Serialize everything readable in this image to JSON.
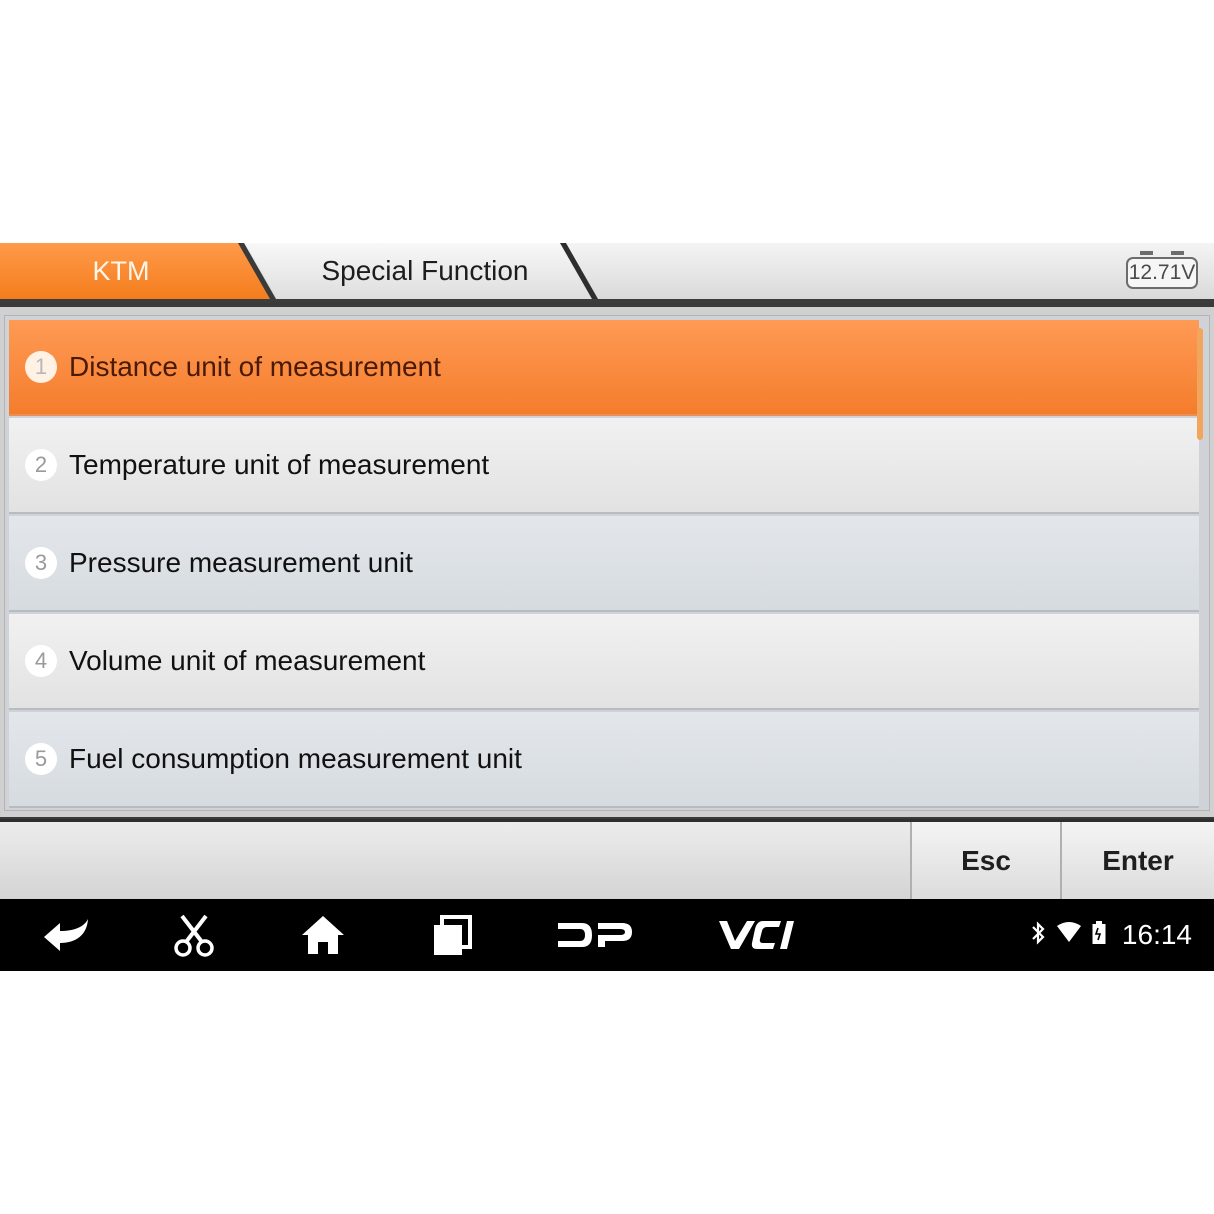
{
  "header": {
    "breadcrumbs": [
      "KTM",
      "Special Function"
    ],
    "voltage": "12.71V"
  },
  "menu": {
    "items": [
      {
        "number": "1",
        "label": "Distance unit of measurement",
        "selected": true
      },
      {
        "number": "2",
        "label": "Temperature unit of measurement",
        "selected": false
      },
      {
        "number": "3",
        "label": "Pressure measurement unit",
        "selected": false
      },
      {
        "number": "4",
        "label": "Volume unit of measurement",
        "selected": false
      },
      {
        "number": "5",
        "label": "Fuel consumption measurement unit",
        "selected": false
      }
    ]
  },
  "buttons": {
    "esc": "Esc",
    "enter": "Enter"
  },
  "navbar": {
    "icons": [
      "back-icon",
      "scissors-icon",
      "home-icon",
      "recent-apps-icon",
      "dp-icon",
      "vci-icon"
    ],
    "dp_label": "DP",
    "vci_label": "VCI"
  },
  "status": {
    "icons": [
      "bluetooth-icon",
      "wifi-icon",
      "battery-icon"
    ],
    "time": "16:14"
  },
  "colors": {
    "accent": "#f47d2c",
    "navbar": "#000000"
  }
}
